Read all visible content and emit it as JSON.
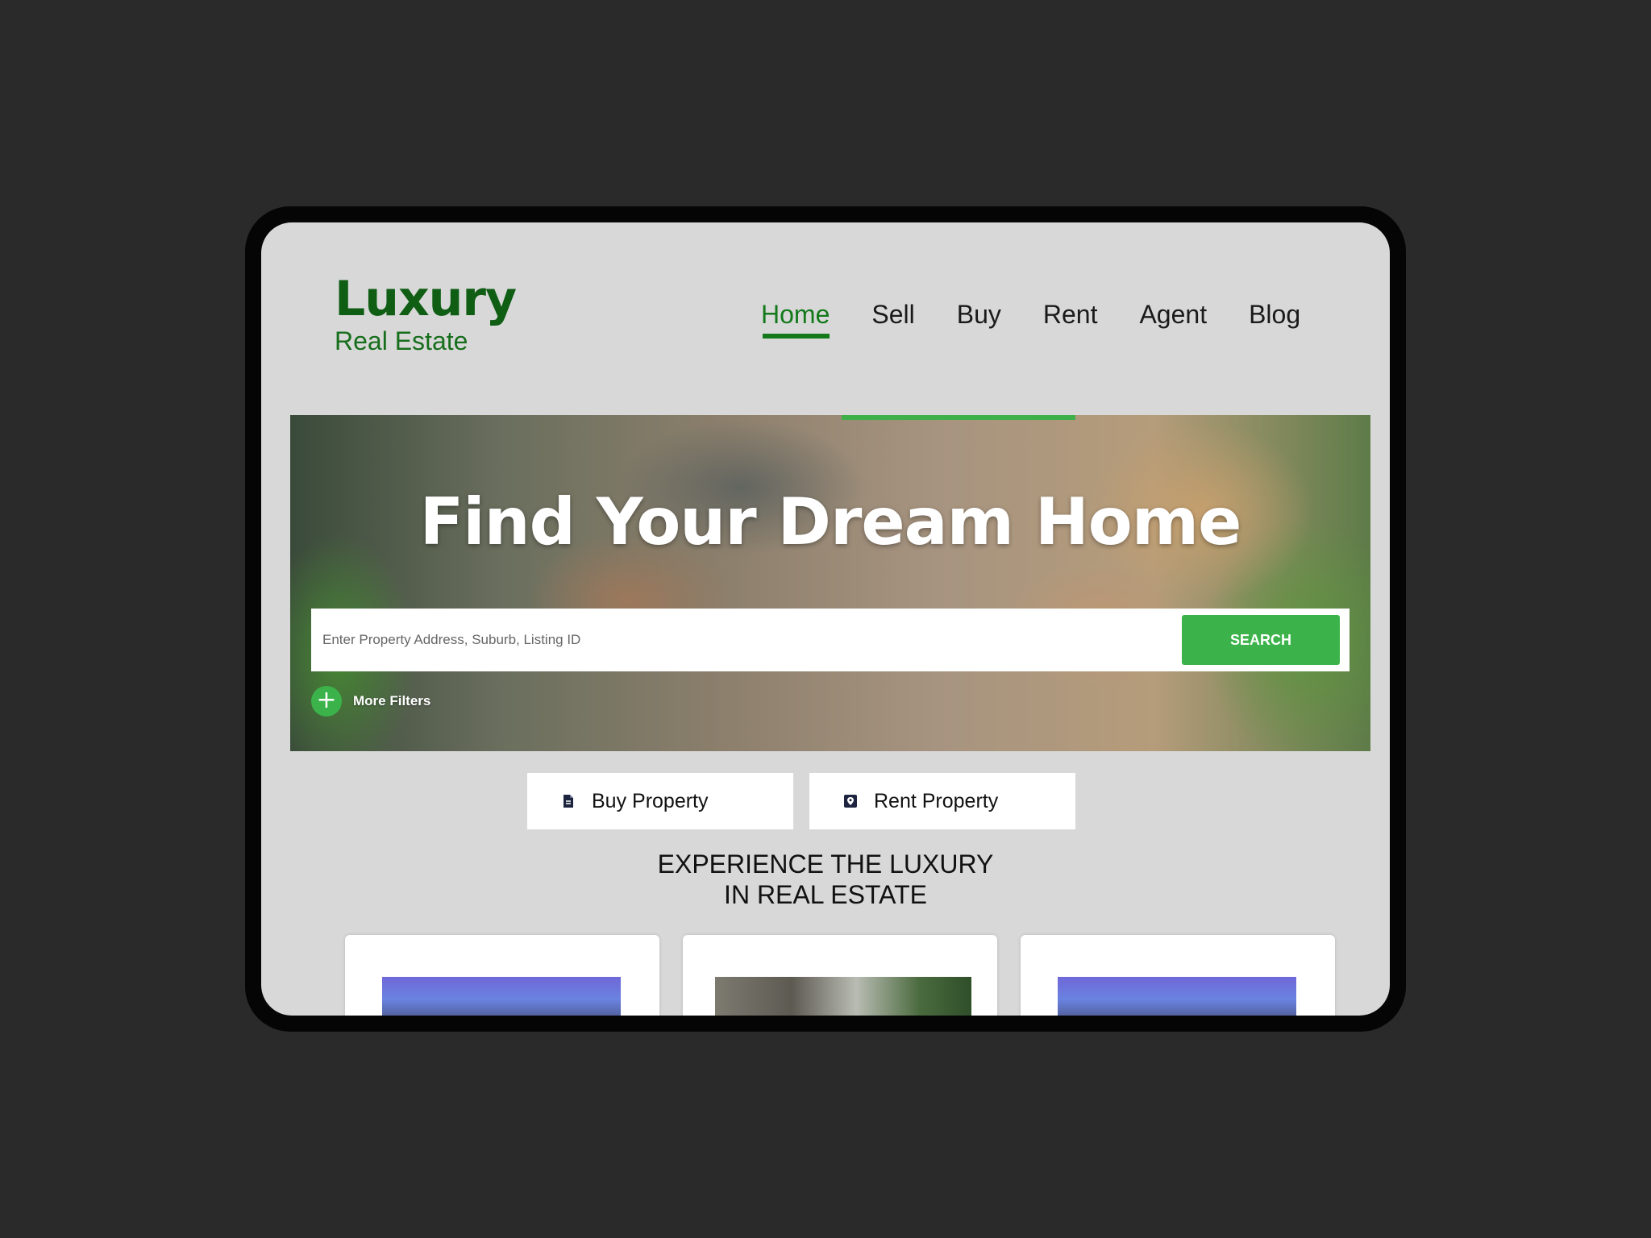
{
  "logo": {
    "title": "Luxury",
    "subtitle": "Real Estate"
  },
  "nav": {
    "items": [
      {
        "label": "Home",
        "active": true
      },
      {
        "label": "Sell"
      },
      {
        "label": "Buy"
      },
      {
        "label": "Rent"
      },
      {
        "label": "Agent"
      },
      {
        "label": "Blog"
      }
    ]
  },
  "hero": {
    "title": "Find Your Dream Home",
    "search_placeholder": "Enter Property Address, Suburb, Listing ID",
    "search_button": "SEARCH",
    "more_filters": "More Filters"
  },
  "tabs": {
    "buy": "Buy Property",
    "rent": "Rent Property"
  },
  "section": {
    "heading_line1": "EXPERIENCE THE LUXURY",
    "heading_line2": "IN REAL ESTATE"
  },
  "colors": {
    "brand_green": "#13791b",
    "accent_green": "#3cb34a",
    "page_bg": "#d8d8d8"
  }
}
